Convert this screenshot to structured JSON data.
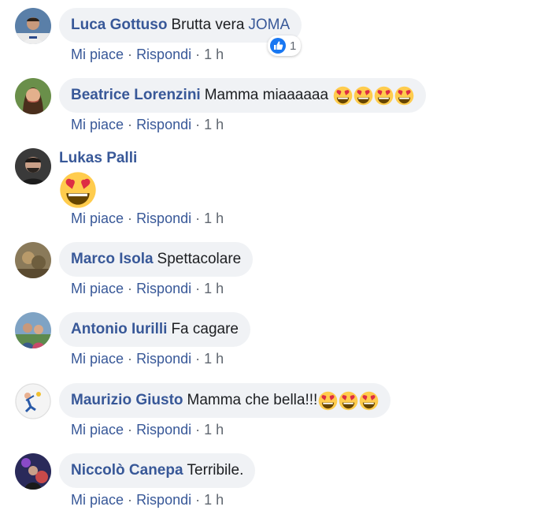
{
  "actions": {
    "like": "Mi piace",
    "reply": "Rispondi",
    "separator": "·"
  },
  "comments": [
    {
      "author": "Luca Gottuso",
      "text": "Brutta vera",
      "tag": "JOMA",
      "time": "1 h",
      "reactions": {
        "icon": "thumbs-up-icon",
        "count": "1"
      }
    },
    {
      "author": "Beatrice Lorenzini",
      "text": "Mamma miaaaaaa",
      "emoji": "heart-eyes-emoji x4",
      "time": "1 h"
    },
    {
      "author": "Lukas Palli",
      "emoji": "heart-eyes-emoji (large)",
      "time": "1 h"
    },
    {
      "author": "Marco Isola",
      "text": "Spettacolare",
      "time": "1 h"
    },
    {
      "author": "Antonio Iurilli",
      "text": "Fa cagare",
      "time": "1 h"
    },
    {
      "author": "Maurizio Giusto",
      "text": "Mamma che bella!!!",
      "emoji": "heart-eyes-emoji x3",
      "time": "1 h"
    },
    {
      "author": "Niccolò Canepa",
      "text": "Terribile.",
      "time": "1 h"
    }
  ],
  "colors": {
    "name": "#385898",
    "bubble": "#f0f2f5",
    "meta": "#606770",
    "like_blue": "#1877f2",
    "emoji_yellow": "#ffcc4d",
    "heart_red": "#dd2e44"
  }
}
